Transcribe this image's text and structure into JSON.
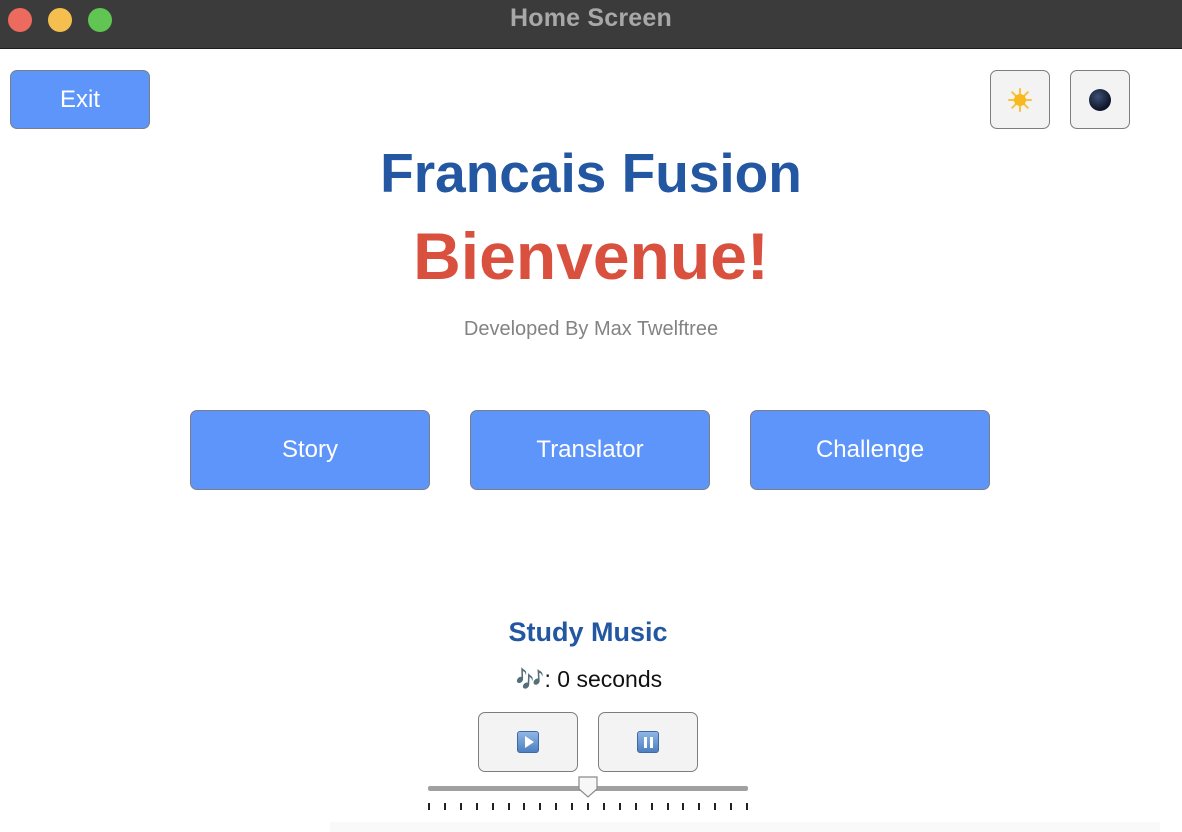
{
  "window": {
    "title": "Home Screen"
  },
  "header": {
    "exit_label": "Exit",
    "light_mode_icon": "sun-icon",
    "dark_mode_icon": "moon-icon"
  },
  "hero": {
    "app_title": "Francais Fusion",
    "welcome": "Bienvenue!",
    "developer": "Developed By Max Twelftree"
  },
  "nav": {
    "story_label": "Story",
    "translator_label": "Translator",
    "challenge_label": "Challenge"
  },
  "music": {
    "title": "Study Music",
    "timer_text": "🎶: 0 seconds",
    "play_icon": "play-icon",
    "pause_icon": "pause-icon",
    "slider": {
      "value": 0.5,
      "tick_count": 21
    }
  },
  "colors": {
    "button_blue": "#5e95fb",
    "title_blue": "#2357a2",
    "welcome_red": "#d9503f",
    "titlebar": "#3b3b3b"
  }
}
